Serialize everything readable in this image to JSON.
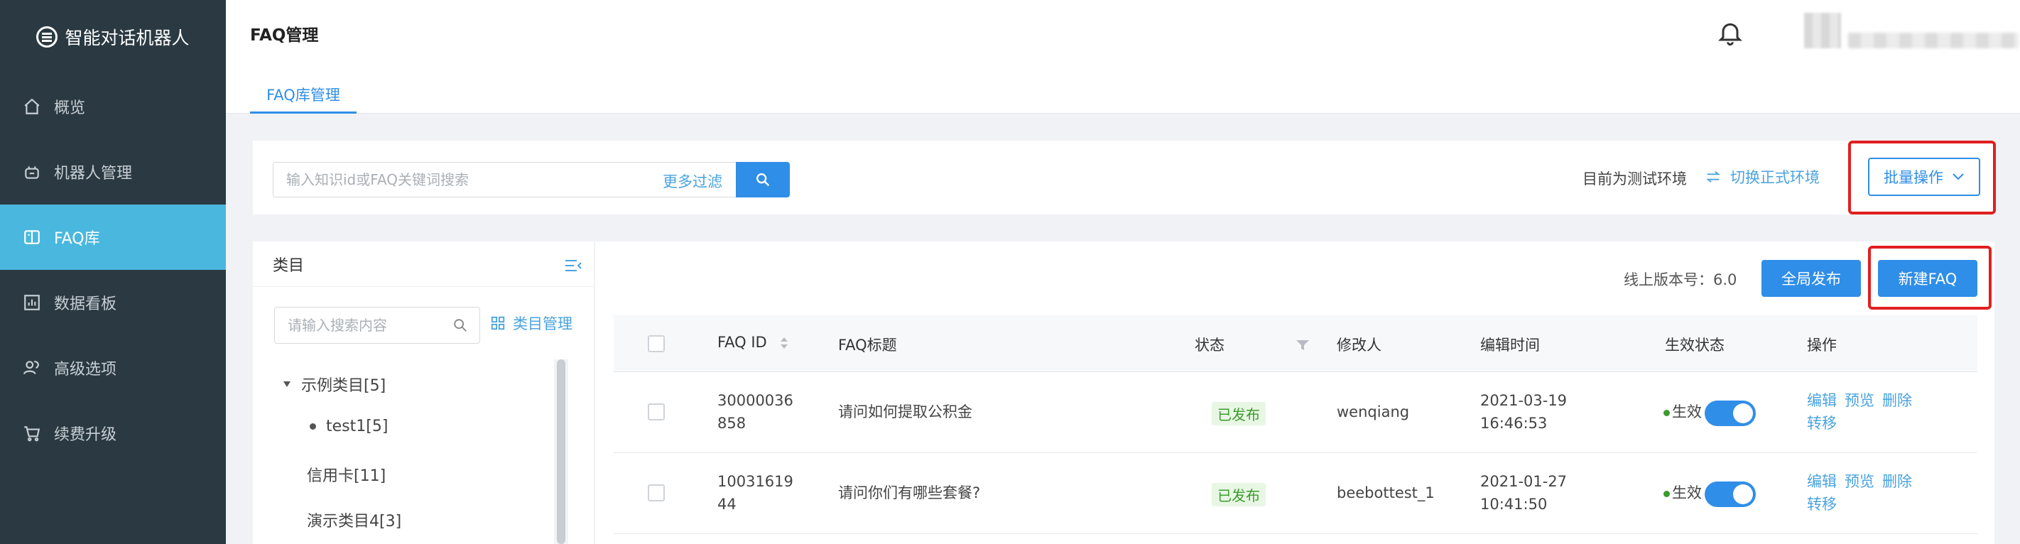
{
  "sidebar": {
    "brand": "智能对话机器人",
    "items": [
      {
        "label": "概览",
        "icon": "home-icon"
      },
      {
        "label": "机器人管理",
        "icon": "robot-icon"
      },
      {
        "label": "FAQ库",
        "icon": "book-icon",
        "active": true
      },
      {
        "label": "数据看板",
        "icon": "dashboard-icon"
      },
      {
        "label": "高级选项",
        "icon": "users-icon"
      },
      {
        "label": "续费升级",
        "icon": "cart-icon"
      }
    ]
  },
  "header": {
    "title": "FAQ管理",
    "tab": "FAQ库管理"
  },
  "search": {
    "placeholder": "输入知识id或FAQ关键词搜索",
    "more_filter": "更多过滤",
    "env_text": "目前为测试环境",
    "env_switch": "切换正式环境",
    "batch": "批量操作"
  },
  "category": {
    "title": "类目",
    "search_placeholder": "请输入搜索内容",
    "manage": "类目管理",
    "tree": [
      {
        "label": "示例类目[5]"
      },
      {
        "label": "test1[5]"
      },
      {
        "label": "信用卡[11]"
      },
      {
        "label": "演示类目4[3]"
      }
    ]
  },
  "toolbar": {
    "version": "线上版本号：6.0",
    "publish": "全局发布",
    "new_faq": "新建FAQ"
  },
  "table": {
    "columns": [
      "FAQ ID",
      "FAQ标题",
      "状态",
      "修改人",
      "编辑时间",
      "生效状态",
      "操作"
    ],
    "rows": [
      {
        "id1": "30000036",
        "id2": "858",
        "title": "请问如何提取公积金",
        "status": "已发布",
        "editor": "wenqiang",
        "date": "2021-03-19",
        "time": "16:46:53",
        "effect": "生效",
        "ops": [
          "编辑",
          "预览",
          "删除",
          "转移"
        ]
      },
      {
        "id1": "10031619",
        "id2": "44",
        "title": "请问你们有哪些套餐?",
        "status": "已发布",
        "editor": "beebottest_1",
        "date": "2021-01-27",
        "time": "10:41:50",
        "effect": "生效",
        "ops": [
          "编辑",
          "预览",
          "删除",
          "转移"
        ]
      }
    ]
  },
  "colors": {
    "accent": "#2f8ee8",
    "sidebar_bg": "#2b3a42",
    "active_nav": "#4ab7de",
    "highlight": "#e02020",
    "success": "#3c9b2e"
  }
}
